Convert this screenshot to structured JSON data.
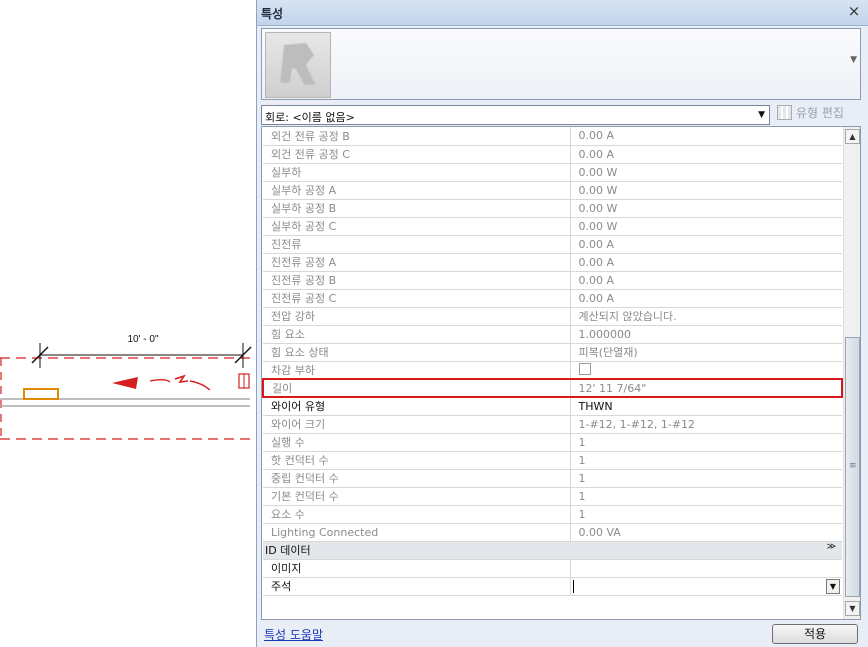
{
  "canvas": {
    "dimension_text": "10' - 0\"",
    "colors": {
      "dashed_boundary": "#d61f1f",
      "fixture": "#e08a00",
      "wire_arrow": "#d61f1f"
    }
  },
  "palette": {
    "title": "특성",
    "close_glyph": "×",
    "selector_text": "회로: <이름 없음>",
    "edit_type_label": "유형 편집",
    "properties": [
      {
        "name": "외건 전류 공정 B",
        "value": "0.00 A",
        "editable": false
      },
      {
        "name": "외건 전류 공정 C",
        "value": "0.00 A",
        "editable": false
      },
      {
        "name": "실부하",
        "value": "0.00 W",
        "editable": false
      },
      {
        "name": "실부하 공정 A",
        "value": "0.00 W",
        "editable": false
      },
      {
        "name": "실부하 공정 B",
        "value": "0.00 W",
        "editable": false
      },
      {
        "name": "실부하 공정 C",
        "value": "0.00 W",
        "editable": false
      },
      {
        "name": "진전류",
        "value": "0.00 A",
        "editable": false
      },
      {
        "name": "진전류 공정 A",
        "value": "0.00 A",
        "editable": false
      },
      {
        "name": "진전류 공정 B",
        "value": "0.00 A",
        "editable": false
      },
      {
        "name": "진전류 공정 C",
        "value": "0.00 A",
        "editable": false
      },
      {
        "name": "전압 강하",
        "value": "계산되지 않았습니다.",
        "editable": false
      },
      {
        "name": "힘 요소",
        "value": "1.000000",
        "editable": false
      },
      {
        "name": "힘 요소 상태",
        "value": "피복(단열재)",
        "editable": false
      },
      {
        "name": "차감 부하",
        "value": "",
        "editable": false,
        "checkbox": true
      },
      {
        "name": "길이",
        "value": "12'  11 7/64\"",
        "editable": false,
        "highlight": true
      },
      {
        "name": "와이어 유형",
        "value": "THWN",
        "editable": true
      },
      {
        "name": "와이어 크기",
        "value": "1-#12, 1-#12, 1-#12",
        "editable": false
      },
      {
        "name": "실행 수",
        "value": "1",
        "editable": false
      },
      {
        "name": "핫 컨덕터 수",
        "value": "1",
        "editable": false
      },
      {
        "name": "중립 컨덕터 수",
        "value": "1",
        "editable": false
      },
      {
        "name": "기본 컨덕터 수",
        "value": "1",
        "editable": false
      },
      {
        "name": "요소 수",
        "value": "1",
        "editable": false
      },
      {
        "name": "Lighting Connected",
        "value": "0.00 VA",
        "editable": false
      }
    ],
    "group_header": {
      "label": "ID 데이터",
      "caret": "≫"
    },
    "id_data": [
      {
        "name": "이미지",
        "value": ""
      },
      {
        "name": "주석",
        "value": ""
      }
    ],
    "help_link": "특성 도움말",
    "apply_button": "적용"
  }
}
